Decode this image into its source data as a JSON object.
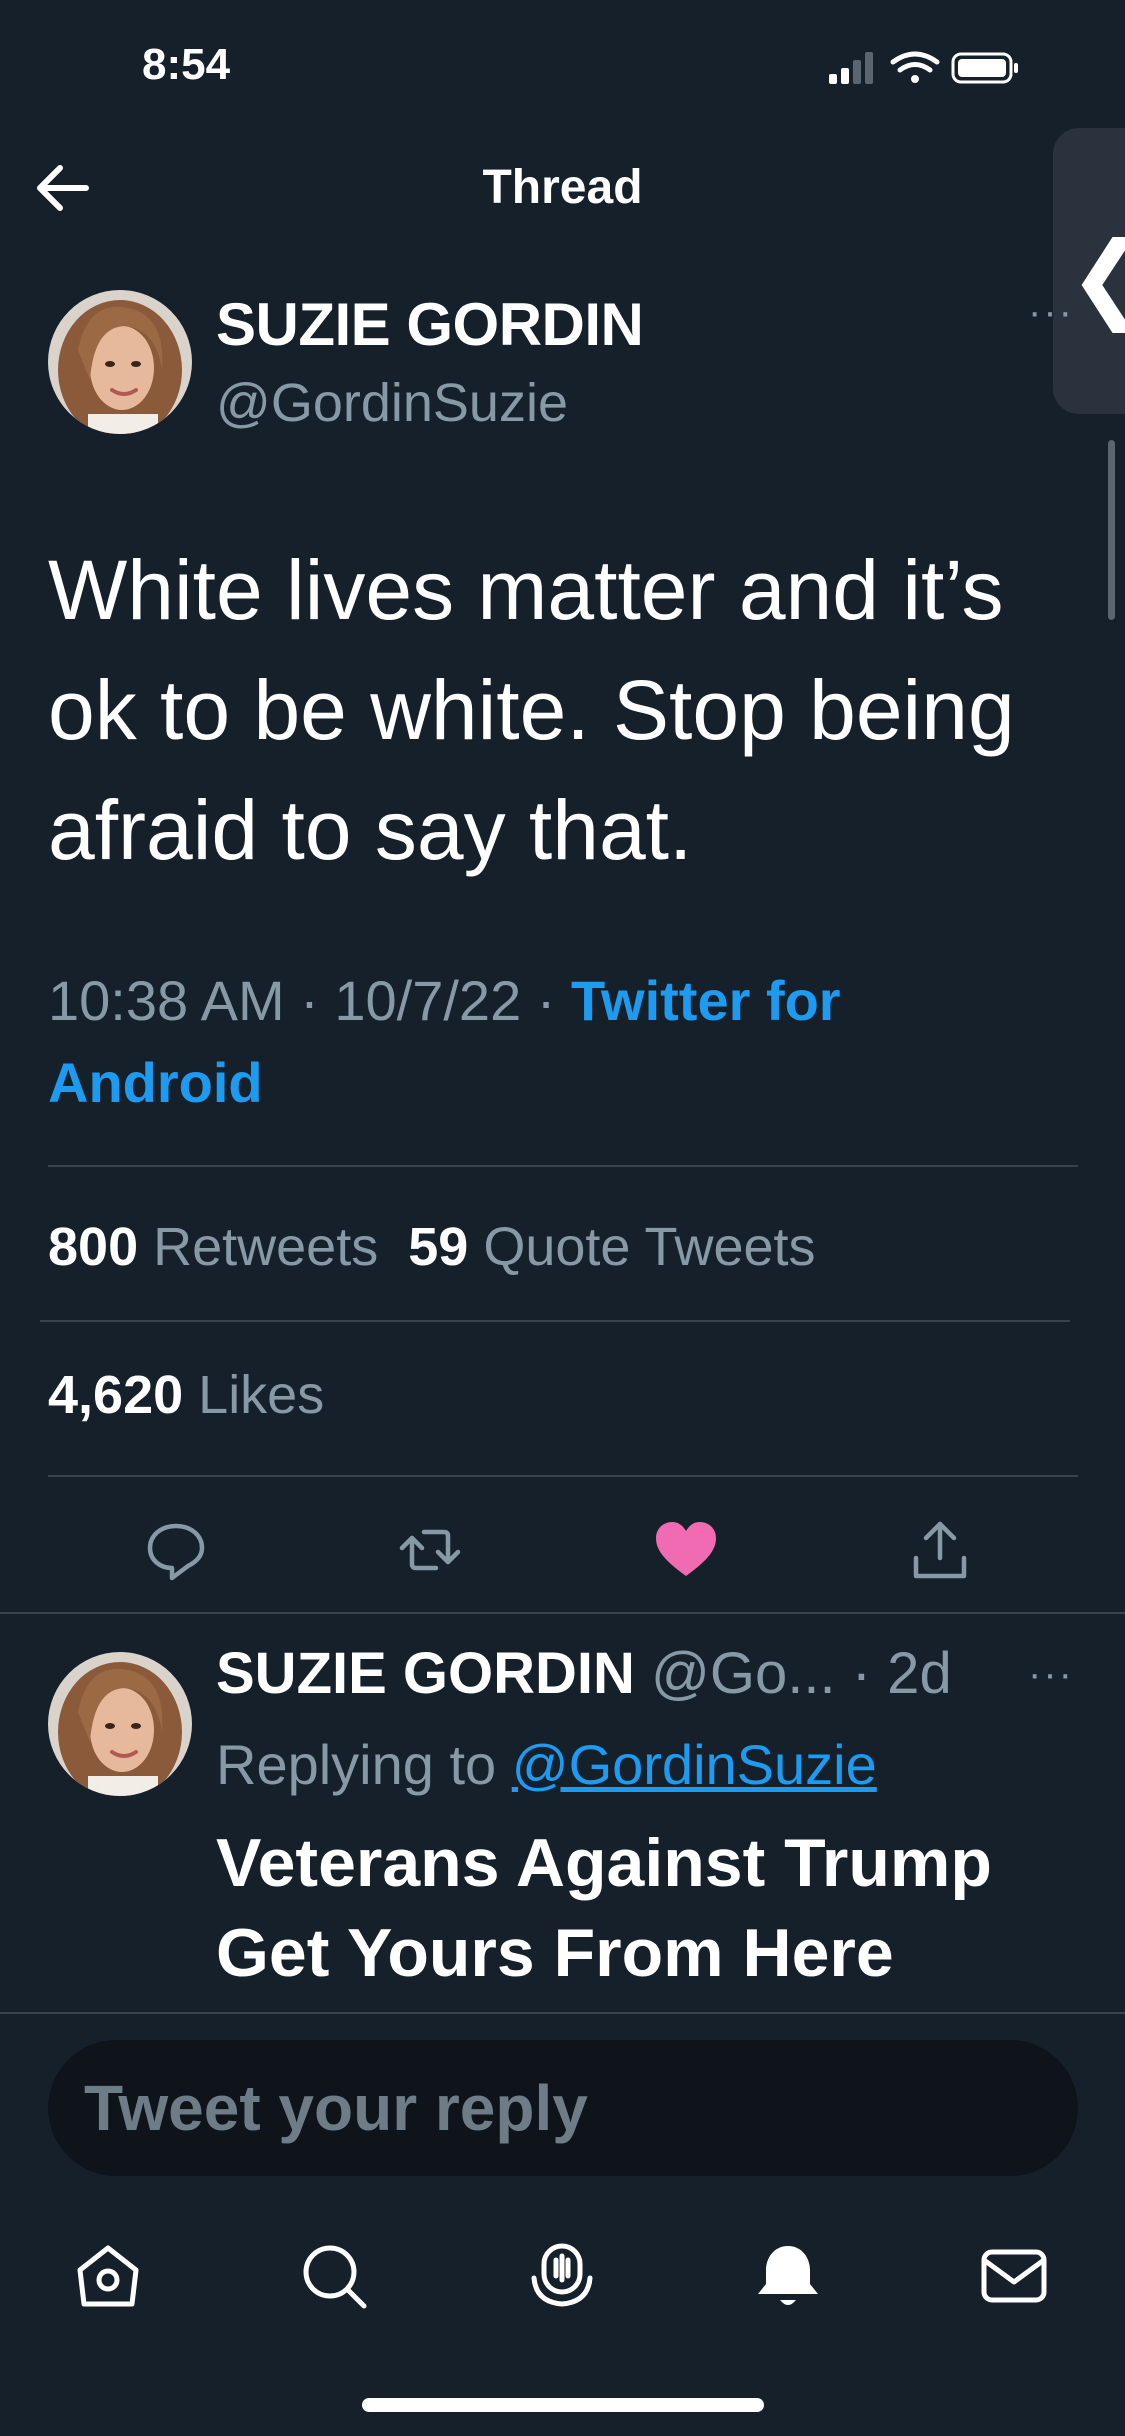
{
  "status_bar": {
    "time": "8:54"
  },
  "header": {
    "title": "Thread"
  },
  "side_tab": {
    "chevron": "❮"
  },
  "main_tweet": {
    "author_name": "SUZIE GORDIN",
    "author_handle": "@GordinSuzie",
    "text": "White lives matter and it’s ok to be white. Stop being afraid to say that.",
    "time": "10:38 AM · 10/7/22 · ",
    "source": "Twitter for Android",
    "retweets_count": "800",
    "retweets_label": "Retweets",
    "quotes_count": "59",
    "quotes_label": "Quote Tweets",
    "likes_count": "4,620",
    "likes_label": "Likes",
    "more_icon": "···"
  },
  "reply": {
    "author_name": "SUZIE GORDIN",
    "handle_date": "@Go... · 2d",
    "replying_prefix": "Replying to ",
    "replying_mention": "@GordinSuzie",
    "text": "Veterans Against Trump Get Yours From Here",
    "more_icon": "···"
  },
  "composer": {
    "placeholder": "Tweet your reply"
  },
  "colors": {
    "background": "#15202b",
    "accent": "#1d9bf0",
    "like": "#f91880",
    "muted": "#8899a6"
  },
  "icons": [
    "back-arrow-icon",
    "reply-icon",
    "retweet-icon",
    "heart-icon",
    "share-icon",
    "home-icon",
    "search-icon",
    "spaces-icon",
    "notifications-icon",
    "messages-icon"
  ]
}
